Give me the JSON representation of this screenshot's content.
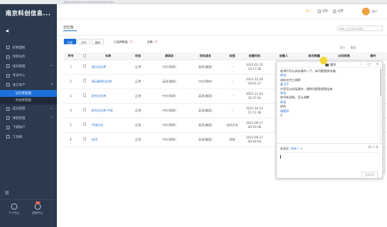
{
  "browser": {
    "url": "https://www.yuque.cn/ebook/portal/index"
  },
  "sidebar": {
    "brand": "南京科创信息...",
    "items": [
      {
        "label": "控制面板"
      },
      {
        "label": "项目任务"
      },
      {
        "label": "培训管理"
      },
      {
        "label": "考试中心"
      },
      {
        "label": "语言资产"
      },
      {
        "label": "记忆库管理",
        "sub": true,
        "active": true
      },
      {
        "label": "术语库管理",
        "sub": true
      },
      {
        "label": "成员管理"
      },
      {
        "label": "课程管理"
      },
      {
        "label": "下级账户"
      },
      {
        "label": "工具箱"
      }
    ],
    "footer": {
      "personal": "个人中心",
      "messages": "消息中心",
      "badge": "99"
    }
  },
  "topbar": {
    "bell": "卡☆",
    "item1": "消息",
    "item2": "设置",
    "user": "用户"
  },
  "page": {
    "tab": "记忆库",
    "search_placeholder": "请输入记忆库名称搜索"
  },
  "filters": {
    "btn_all": "全部",
    "btn_merge": "合并",
    "btn_delete": "删除",
    "selected_label": "已选择数量：",
    "selected_count": "0",
    "total_label": "总数：",
    "total_count": "6"
  },
  "toolbar": {
    "import": "导入",
    "export": "导出"
  },
  "table": {
    "headers": [
      "序号",
      "",
      "名称",
      "状态",
      "源语言",
      "目标语言",
      "标签",
      "创建时间",
      "创建人",
      "条目数量",
      "访问权限",
      "操作"
    ],
    "rows": [
      {
        "no": "1",
        "name": "演示记忆库",
        "status": "正常",
        "src": "中文(简体)",
        "tgt": "英语(美国)",
        "tag": "--",
        "date": "2022-01-12",
        "time": "10:17:36"
      },
      {
        "no": "2",
        "name": "演示翻译记忆库",
        "status": "正常",
        "src": "英语(美国)",
        "tgt": "中文(简体)",
        "tag": "--",
        "date": "2021-12-29",
        "time": "16:01:27"
      },
      {
        "no": "3",
        "name": "综合记忆库",
        "status": "正常",
        "src": "中文(简体)",
        "tgt": "英语(美国)",
        "tag": "--",
        "date": "2021-11-03",
        "time": "16:37:31"
      },
      {
        "no": "4",
        "name": "综合记忆库-中英",
        "status": "正常",
        "src": "中文(简体)",
        "tgt": "英语(美国)",
        "tag": "--",
        "date": "2021-10-14",
        "time": "11:11:38"
      },
      {
        "no": "5",
        "name": "中国文化",
        "status": "正常",
        "src": "中文(简体)",
        "tgt": "英语(美国)",
        "tag": "社科文化",
        "date": "2021-09-17",
        "time": "09:19:36"
      },
      {
        "no": "6",
        "name": "经济",
        "status": "正常",
        "src": "中文(简体)",
        "tgt": "英语(美国)",
        "tag": "财经",
        "date": "2021-09-17",
        "time": "09:18:49"
      }
    ]
  },
  "chat": {
    "title": "聊天",
    "messages": [
      {
        "sender": "",
        "text": "老师们可以实际操作一下、有问题直接沟通。"
      },
      {
        "sender": "钟浩",
        "text": "选料对齐工具呢"
      },
      {
        "sender": "姜卫平",
        "text": "大家可以实际操作，遇到问题直接提出来"
      },
      {
        "sender": "钟浩",
        "text": "知乎有误呢，怎么调整"
      },
      {
        "sender": "钟浩",
        "text": "好的"
      },
      {
        "sender": "储建萍",
        "text": "3"
      }
    ],
    "to_label": "发送至:",
    "to_who": "所有人",
    "send": "发送(S)"
  }
}
